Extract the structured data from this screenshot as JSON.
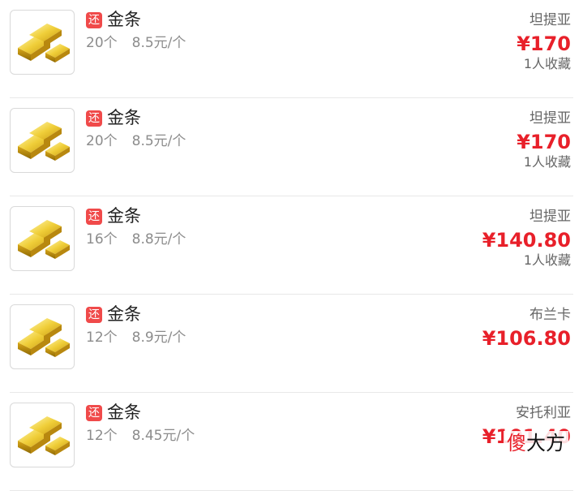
{
  "listings": [
    {
      "tag": "还",
      "title": "金条",
      "quantity": "20个",
      "unit_price": "8.5元/个",
      "seller": "坦提亚",
      "price": "¥170",
      "favorites": "1人收藏"
    },
    {
      "tag": "还",
      "title": "金条",
      "quantity": "20个",
      "unit_price": "8.5元/个",
      "seller": "坦提亚",
      "price": "¥170",
      "favorites": "1人收藏"
    },
    {
      "tag": "还",
      "title": "金条",
      "quantity": "16个",
      "unit_price": "8.8元/个",
      "seller": "坦提亚",
      "price": "¥140.80",
      "favorites": "1人收藏"
    },
    {
      "tag": "还",
      "title": "金条",
      "quantity": "12个",
      "unit_price": "8.9元/个",
      "seller": "布兰卡",
      "price": "¥106.80",
      "favorites": ""
    },
    {
      "tag": "还",
      "title": "金条",
      "quantity": "12个",
      "unit_price": "8.45元/个",
      "seller": "安托利亚",
      "price": "¥101.40",
      "favorites": ""
    }
  ],
  "watermark": {
    "first": "傻",
    "rest": "大方"
  },
  "colors": {
    "price": "#e8202a",
    "tag_bg": "#f04a4a",
    "gold": "#e3b820"
  },
  "icons": {
    "item_image": "gold-bar-icon"
  }
}
